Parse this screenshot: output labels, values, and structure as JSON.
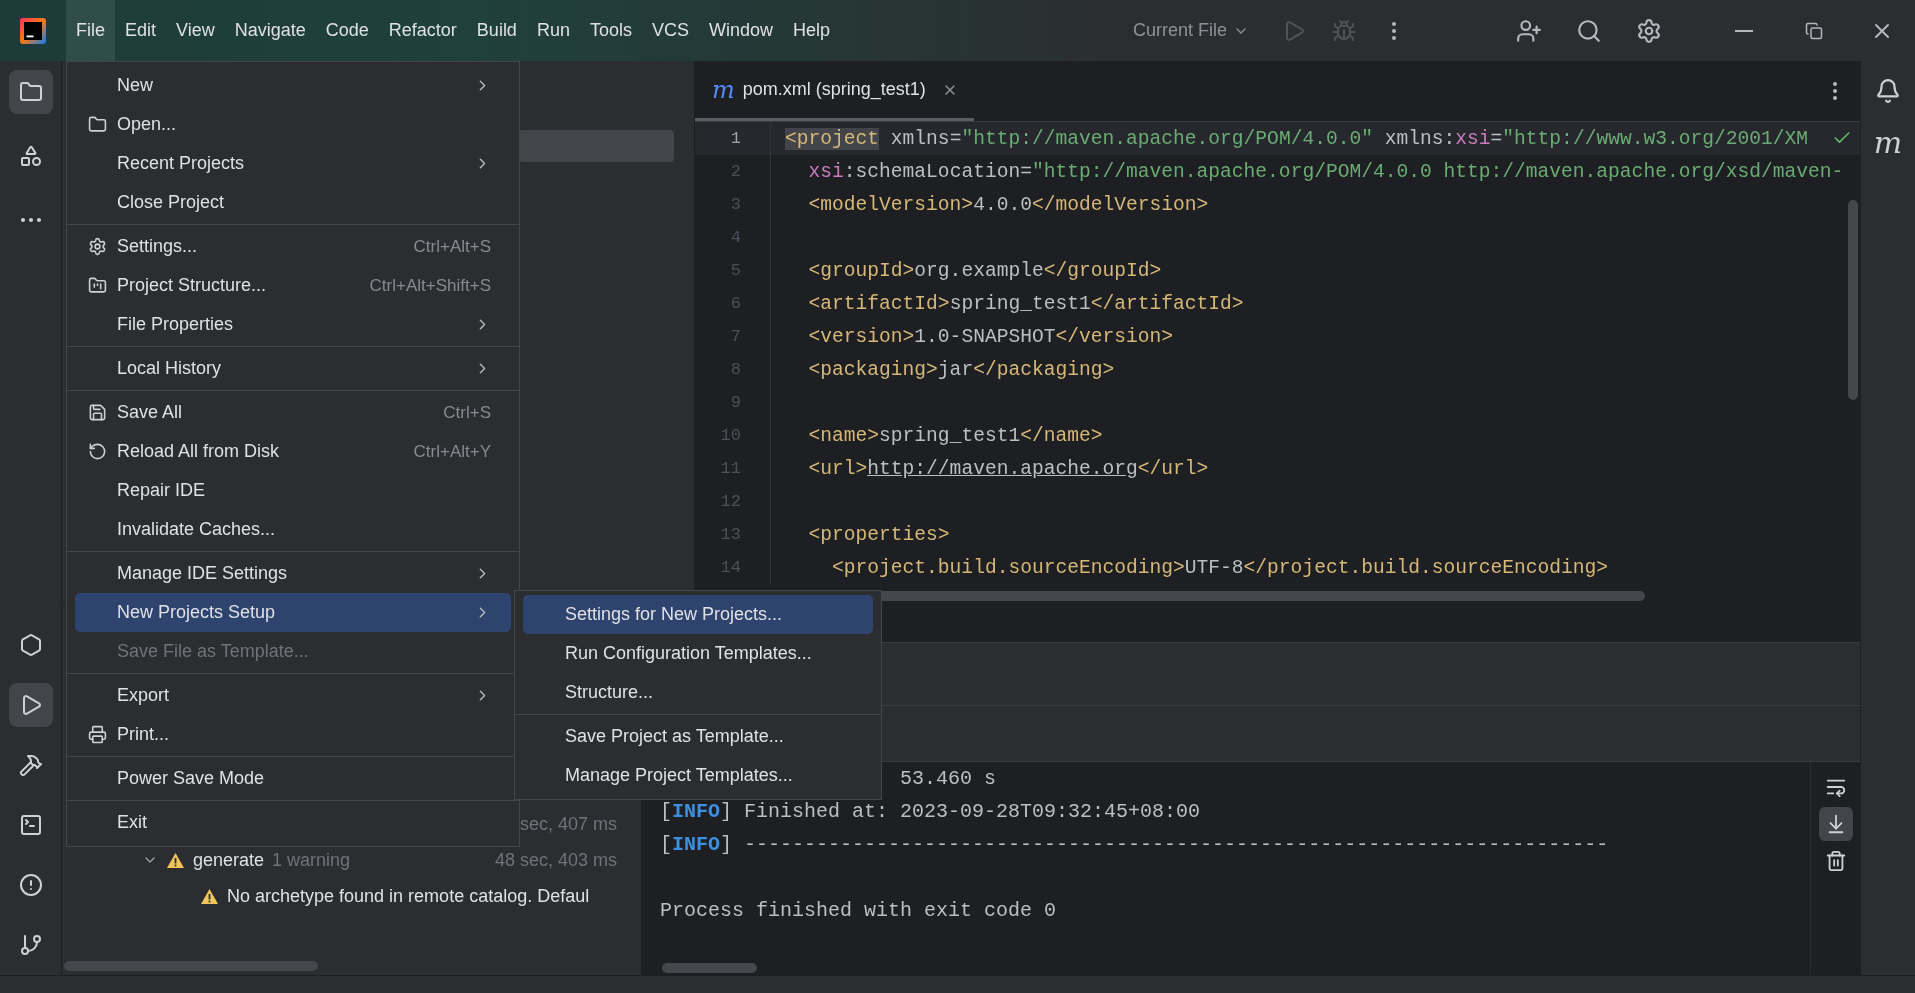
{
  "title_bar": {
    "menus": [
      {
        "label": "File",
        "selected": true
      },
      {
        "label": "Edit",
        "selected": false
      },
      {
        "label": "View",
        "selected": false
      },
      {
        "label": "Navigate",
        "selected": false
      },
      {
        "label": "Code",
        "selected": false
      },
      {
        "label": "Refactor",
        "selected": false
      },
      {
        "label": "Build",
        "selected": false
      },
      {
        "label": "Run",
        "selected": false
      },
      {
        "label": "Tools",
        "selected": false
      },
      {
        "label": "VCS",
        "selected": false
      },
      {
        "label": "Window",
        "selected": false
      },
      {
        "label": "Help",
        "selected": false
      }
    ],
    "run_config": "Current File"
  },
  "left_toolbar": {
    "top": [
      {
        "selected": true
      },
      {
        "selected": false
      },
      {
        "selected": false
      }
    ],
    "bottom": [
      {
        "selected": false
      },
      {
        "selected": true
      },
      {
        "selected": false
      },
      {
        "selected": false
      },
      {
        "selected": false
      },
      {
        "selected": false
      }
    ]
  },
  "right_toolbar": {
    "maven_label": "m"
  },
  "editor": {
    "tab": {
      "file_icon": "m",
      "label": "pom.xml (spring_test1)",
      "selected": true
    },
    "lines": [
      {
        "number": "1",
        "current": true,
        "tokens": [
          {
            "kind": "tag-match",
            "text": "<project"
          },
          {
            "kind": "attr",
            "text": " xmlns"
          },
          {
            "kind": "text",
            "text": "="
          },
          {
            "kind": "value",
            "text": "\"http://maven.apache.org/POM/4.0.0\""
          },
          {
            "kind": "attr",
            "text": " xmlns"
          },
          {
            "kind": "text",
            "text": ":"
          },
          {
            "kind": "ns",
            "text": "xsi"
          },
          {
            "kind": "text",
            "text": "="
          },
          {
            "kind": "value",
            "text": "\"http://www.w3.org/2001/XM"
          }
        ]
      },
      {
        "number": "2",
        "current": false,
        "tokens": [
          {
            "kind": "ns",
            "text": "  xsi"
          },
          {
            "kind": "text",
            "text": ":"
          },
          {
            "kind": "attr",
            "text": "schemaLocation"
          },
          {
            "kind": "text",
            "text": "="
          },
          {
            "kind": "value",
            "text": "\"http://maven.apache.org/POM/4.0.0 http://maven.apache.org/xsd/maven-"
          }
        ]
      },
      {
        "number": "3",
        "current": false,
        "tokens": [
          {
            "kind": "tag",
            "text": "  <modelVersion>"
          },
          {
            "kind": "text",
            "text": "4.0.0"
          },
          {
            "kind": "tag",
            "text": "</modelVersion>"
          }
        ]
      },
      {
        "number": "4",
        "current": false
      },
      {
        "number": "5",
        "current": false,
        "tokens": [
          {
            "kind": "tag",
            "text": "  <groupId>"
          },
          {
            "kind": "text",
            "text": "org.example"
          },
          {
            "kind": "tag",
            "text": "</groupId>"
          }
        ]
      },
      {
        "number": "6",
        "current": false,
        "tokens": [
          {
            "kind": "tag",
            "text": "  <artifactId>"
          },
          {
            "kind": "text",
            "text": "spring_test1"
          },
          {
            "kind": "tag",
            "text": "</artifactId>"
          }
        ]
      },
      {
        "number": "7",
        "current": false,
        "tokens": [
          {
            "kind": "tag",
            "text": "  <version>"
          },
          {
            "kind": "text",
            "text": "1.0-SNAPSHOT"
          },
          {
            "kind": "tag",
            "text": "</version>"
          }
        ]
      },
      {
        "number": "8",
        "current": false,
        "tokens": [
          {
            "kind": "tag",
            "text": "  <packaging>"
          },
          {
            "kind": "text",
            "text": "jar"
          },
          {
            "kind": "tag",
            "text": "</packaging>"
          }
        ]
      },
      {
        "number": "9",
        "current": false
      },
      {
        "number": "10",
        "current": false,
        "tokens": [
          {
            "kind": "tag",
            "text": "  <name>"
          },
          {
            "kind": "text",
            "text": "spring_test1"
          },
          {
            "kind": "tag",
            "text": "</name>"
          }
        ]
      },
      {
        "number": "11",
        "current": false,
        "tokens": [
          {
            "kind": "tag",
            "text": "  <url>"
          },
          {
            "kind": "link",
            "text": "http://maven.apache.org"
          },
          {
            "kind": "tag",
            "text": "</url>"
          }
        ]
      },
      {
        "number": "12",
        "current": false
      },
      {
        "number": "13",
        "current": false,
        "tokens": [
          {
            "kind": "tag",
            "text": "  <properties>"
          }
        ]
      },
      {
        "number": "14",
        "current": false,
        "tokens": [
          {
            "kind": "tag",
            "text": "    <project.build.sourceEncoding>"
          },
          {
            "kind": "text",
            "text": "UTF-8"
          },
          {
            "kind": "tag",
            "text": "</project.build.sourceEncoding>"
          }
        ]
      }
    ]
  },
  "run_panel": {
    "tree": [
      {
        "kind": "task-time",
        "time": "sec, 407 ms"
      },
      {
        "kind": "task",
        "label": "generate",
        "note": "1 warning",
        "time": "48 sec, 403 ms",
        "expanded": true
      },
      {
        "kind": "message",
        "label": "No archetype found in remote catalog. Defaul"
      }
    ],
    "console": [
      {
        "kind": "continued",
        "tokens": [
          {
            "kind": "text",
            "text": "53.460 s"
          }
        ]
      },
      {
        "kind": "line",
        "tokens": [
          {
            "kind": "text",
            "text": "["
          },
          {
            "kind": "info",
            "text": "INFO"
          },
          {
            "kind": "text",
            "text": "] Finished at: 2023-09-28T09:32:45+08:00"
          }
        ]
      },
      {
        "kind": "line",
        "tokens": [
          {
            "kind": "text",
            "text": "["
          },
          {
            "kind": "info",
            "text": "INFO"
          },
          {
            "kind": "text",
            "text": "] ------------------------------------------------------------------------"
          }
        ]
      },
      {
        "kind": "blank"
      },
      {
        "kind": "line",
        "tokens": [
          {
            "kind": "text",
            "text": "Process finished with exit code 0"
          }
        ]
      }
    ],
    "console_tools": [
      {
        "selected": false
      },
      {
        "selected": true
      },
      {
        "selected": false
      }
    ]
  },
  "file_menu": {
    "groups": [
      [
        {
          "label": "New",
          "submenu": true,
          "selected": false,
          "disabled": false
        },
        {
          "label": "Open...",
          "submenu": false,
          "selected": false,
          "disabled": false
        },
        {
          "label": "Recent Projects",
          "submenu": true,
          "selected": false,
          "disabled": false
        },
        {
          "label": "Close Project",
          "submenu": false,
          "selected": false,
          "disabled": false
        }
      ],
      [
        {
          "label": "Settings...",
          "shortcut": "Ctrl+Alt+S",
          "submenu": false,
          "selected": false,
          "disabled": false
        },
        {
          "label": "Project Structure...",
          "shortcut": "Ctrl+Alt+Shift+S",
          "submenu": false,
          "selected": false,
          "disabled": false
        },
        {
          "label": "File Properties",
          "submenu": true,
          "selected": false,
          "disabled": false
        }
      ],
      [
        {
          "label": "Local History",
          "submenu": true,
          "selected": false,
          "disabled": false
        }
      ],
      [
        {
          "label": "Save All",
          "shortcut": "Ctrl+S",
          "submenu": false,
          "selected": false,
          "disabled": false
        },
        {
          "label": "Reload All from Disk",
          "shortcut": "Ctrl+Alt+Y",
          "submenu": false,
          "selected": false,
          "disabled": false
        },
        {
          "label": "Repair IDE",
          "submenu": false,
          "selected": false,
          "disabled": false
        },
        {
          "label": "Invalidate Caches...",
          "submenu": false,
          "selected": false,
          "disabled": false
        }
      ],
      [
        {
          "label": "Manage IDE Settings",
          "submenu": true,
          "selected": false,
          "disabled": false
        },
        {
          "label": "New Projects Setup",
          "submenu": true,
          "selected": true,
          "disabled": false
        },
        {
          "label": "Save File as Template...",
          "submenu": false,
          "selected": false,
          "disabled": true
        }
      ],
      [
        {
          "label": "Export",
          "submenu": true,
          "selected": false,
          "disabled": false
        },
        {
          "label": "Print...",
          "submenu": false,
          "selected": false,
          "disabled": false
        }
      ],
      [
        {
          "label": "Power Save Mode",
          "submenu": false,
          "selected": false,
          "disabled": false
        }
      ],
      [
        {
          "label": "Exit",
          "submenu": false,
          "selected": false,
          "disabled": false
        }
      ]
    ]
  },
  "submenu": {
    "groups": [
      [
        {
          "label": "Settings for New Projects...",
          "selected": true
        },
        {
          "label": "Run Configuration Templates...",
          "selected": false
        },
        {
          "label": "Structure...",
          "selected": false
        }
      ],
      [
        {
          "label": "Save Project as Template...",
          "selected": false
        },
        {
          "label": "Manage Project Templates...",
          "selected": false
        }
      ]
    ]
  }
}
